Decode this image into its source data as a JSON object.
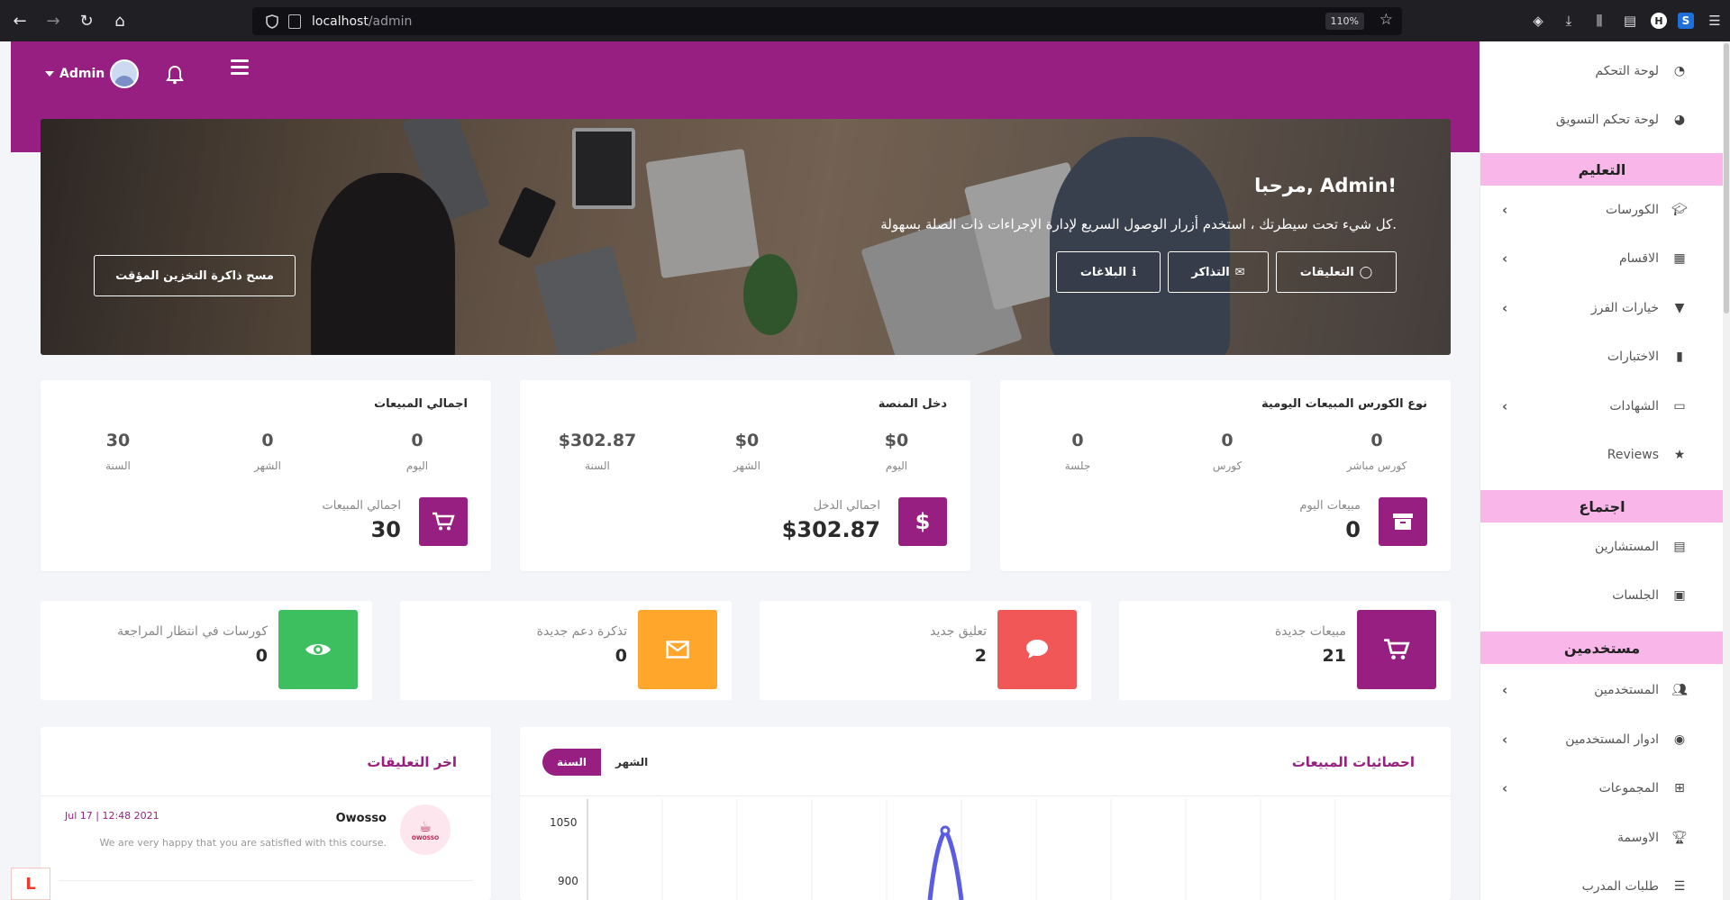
{
  "browser": {
    "url_host": "localhost",
    "url_path": "/admin",
    "zoom": "110%"
  },
  "header": {
    "user": "Admin"
  },
  "hero": {
    "title": "مرحبا, Admin!",
    "subtitle": "كل شيء تحت سيطرتك ، استخدم أزرار الوصول السريع لإدارة الإجراءات ذات الصلة بسهولة.",
    "buttons": [
      "التعليقات",
      "التذاكر",
      "البلاغات"
    ],
    "clear_cache": "مسح ذاكرة التخزين المؤقت"
  },
  "cards": {
    "daily_sales_type": {
      "title": "نوع الكورس المبيعات اليومية",
      "cols": [
        {
          "value": "0",
          "label": "كورس مباشر"
        },
        {
          "value": "0",
          "label": "كورس"
        },
        {
          "value": "0",
          "label": "جلسة"
        }
      ],
      "big_label": "مبيعات اليوم",
      "big_value": "0"
    },
    "platform_income": {
      "title": "دخل المنصة",
      "cols": [
        {
          "value": "$0",
          "label": "اليوم"
        },
        {
          "value": "$0",
          "label": "الشهر"
        },
        {
          "value": "$302.87",
          "label": "السنة"
        }
      ],
      "big_label": "اجمالي الدخل",
      "big_value": "$302.87"
    },
    "total_sales": {
      "title": "اجمالي المبيعات",
      "cols": [
        {
          "value": "0",
          "label": "اليوم"
        },
        {
          "value": "0",
          "label": "الشهر"
        },
        {
          "value": "30",
          "label": "السنة"
        }
      ],
      "big_label": "اجمالي المبيعات",
      "big_value": "30"
    }
  },
  "mini": [
    {
      "label": "مبيعات جديدة",
      "value": "21",
      "color": "#971f81",
      "icon": "cart-icon"
    },
    {
      "label": "تعليق جديد",
      "value": "2",
      "color": "#f25757",
      "icon": "comment-icon"
    },
    {
      "label": "تذكرة دعم جديدة",
      "value": "0",
      "color": "#ffa62b",
      "icon": "envelope-icon"
    },
    {
      "label": "كورسات في انتظار المراجعة",
      "value": "0",
      "color": "#3dbf5f",
      "icon": "eye-icon"
    }
  ],
  "stats": {
    "title": "احصائيات المبيعات",
    "tab_month": "الشهر",
    "tab_year": "السنة",
    "y_ticks": [
      "1050",
      "900"
    ]
  },
  "comments": {
    "title": "اخر التعليقات",
    "items": [
      {
        "name": "Owosso",
        "date": "Jul 17 | 12:48 2021",
        "text": "We are very happy that you are satisfied with this course.",
        "avatar_text": "OWOSSO"
      }
    ]
  },
  "sidebar": {
    "top": [
      {
        "label": "لوحة التحكم",
        "icon": "dashboard-icon"
      },
      {
        "label": "لوحة تحكم التسويق",
        "icon": "pie-chart-icon"
      }
    ],
    "sections": [
      {
        "title": "التعليم",
        "items": [
          {
            "label": "الكورسات",
            "icon": "graduation-cap-icon",
            "chevron": true
          },
          {
            "label": "الاقسام",
            "icon": "grid-icon",
            "chevron": true
          },
          {
            "label": "خيارات الفرز",
            "icon": "filter-icon",
            "chevron": true
          },
          {
            "label": "الاختبارات",
            "icon": "file-icon",
            "chevron": false
          },
          {
            "label": "الشهادات",
            "icon": "certificate-icon",
            "chevron": true
          },
          {
            "label": "Reviews",
            "icon": "star-icon",
            "chevron": false
          }
        ]
      },
      {
        "title": "اجتماع",
        "items": [
          {
            "label": "المستشارين",
            "icon": "id-card-icon",
            "chevron": false
          },
          {
            "label": "الجلسات",
            "icon": "contact-book-icon",
            "chevron": false
          }
        ]
      },
      {
        "title": "مستخدمين",
        "items": [
          {
            "label": "المستخدمين",
            "icon": "users-icon",
            "chevron": true
          },
          {
            "label": "ادوار المستخدمين",
            "icon": "user-circle-icon",
            "chevron": true
          },
          {
            "label": "المجموعات",
            "icon": "sitemap-icon",
            "chevron": true
          },
          {
            "label": "الاوسمة",
            "icon": "trophy-icon",
            "chevron": false
          },
          {
            "label": "طلبات المدرب",
            "icon": "list-icon",
            "chevron": false
          }
        ]
      }
    ]
  }
}
